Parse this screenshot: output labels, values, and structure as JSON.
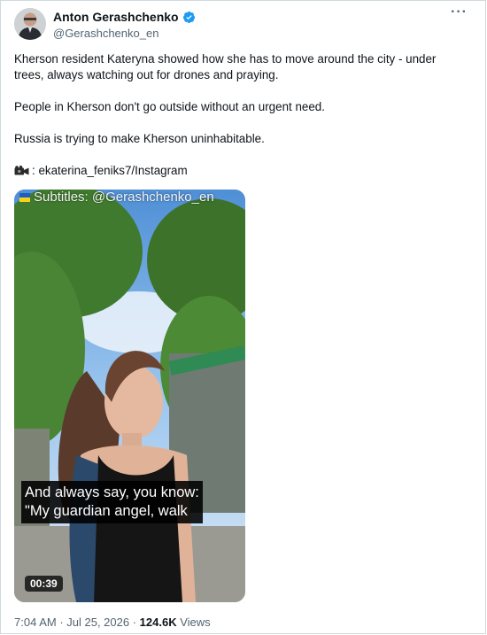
{
  "tweet": {
    "author_name": "Anton Gerashchenko",
    "author_handle": "@Gerashchenko_en",
    "more_label": "···",
    "paragraphs": [
      "Kherson resident Kateryna showed how she has to move around the city - under trees, always watching out for drones and praying.",
      "People in Kherson don't go outside without an urgent need.",
      "Russia is trying to make Kherson uninhabitable."
    ],
    "source_icon": "camera-icon",
    "source_text": ": ekaterina_feniks7/Instagram"
  },
  "video": {
    "top_overlay": "Subtitles: @Gerashchenko_en",
    "caption_line1": "And always say, you know:",
    "caption_line2": "\"My guardian angel, walk",
    "duration": "00:39"
  },
  "meta": {
    "time": "7:04 AM",
    "separator": " · ",
    "date": "Jul 25, 2026",
    "separator2": " · ",
    "views_count": "124.6K",
    "views_label": " Views"
  },
  "colors": {
    "verified": "#1d9bf0",
    "secondary_text": "#536471",
    "primary_text": "#0f1419"
  }
}
